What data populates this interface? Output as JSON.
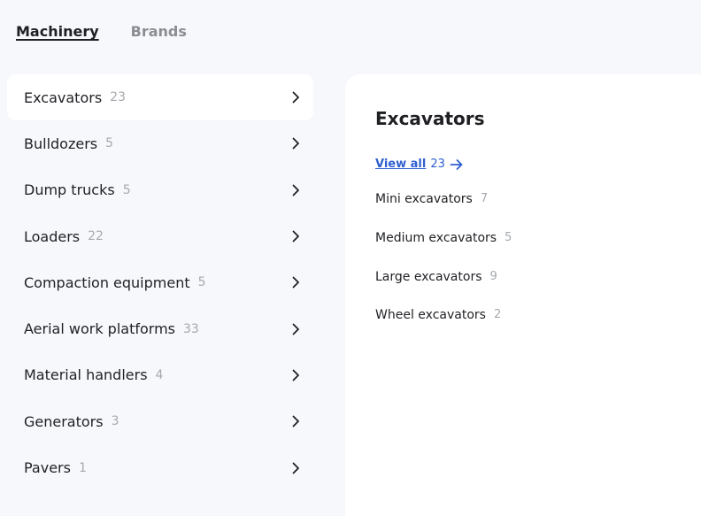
{
  "tabs": [
    {
      "label": "Machinery",
      "active": true
    },
    {
      "label": "Brands",
      "active": false
    }
  ],
  "categories": [
    {
      "label": "Excavators",
      "count": "23"
    },
    {
      "label": "Bulldozers",
      "count": "5"
    },
    {
      "label": "Dump trucks",
      "count": "5"
    },
    {
      "label": "Loaders",
      "count": "22"
    },
    {
      "label": "Compaction equipment",
      "count": "5"
    },
    {
      "label": "Aerial work platforms",
      "count": "33"
    },
    {
      "label": "Material handlers",
      "count": "4"
    },
    {
      "label": "Generators",
      "count": "3"
    },
    {
      "label": "Pavers",
      "count": "1"
    }
  ],
  "panel": {
    "title": "Excavators",
    "view_all_label": "View all",
    "view_all_count": "23",
    "subcategories": [
      {
        "label": "Mini excavators",
        "count": "7"
      },
      {
        "label": "Medium excavators",
        "count": "5"
      },
      {
        "label": "Large excavators",
        "count": "9"
      },
      {
        "label": "Wheel excavators",
        "count": "2"
      }
    ]
  },
  "colors": {
    "link": "#2f5fd0",
    "count_gray": "#a6a9ae",
    "page_bg": "#f6f8fb"
  }
}
